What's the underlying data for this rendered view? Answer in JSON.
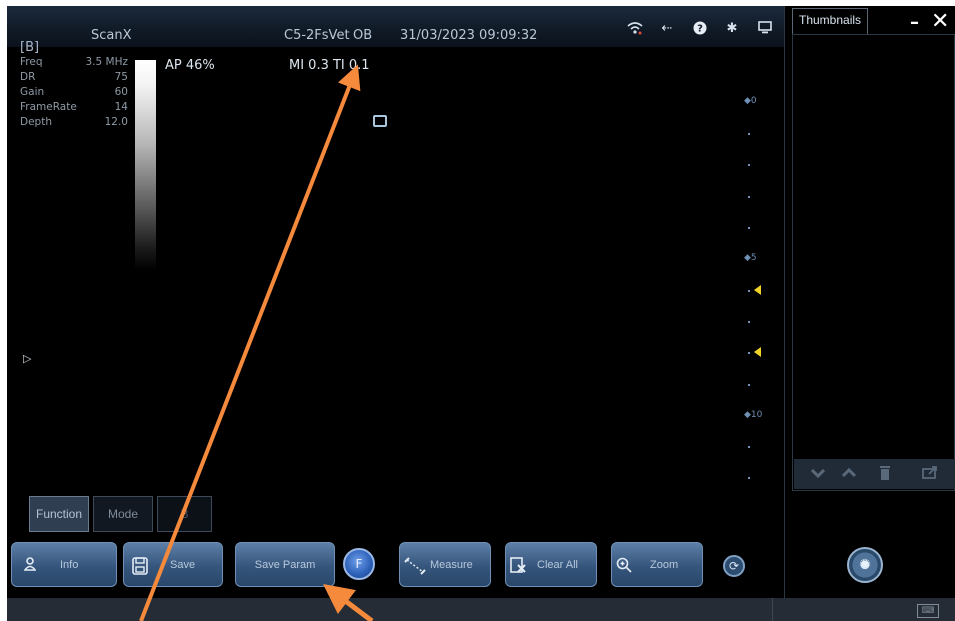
{
  "header": {
    "app_name": "ScanX",
    "probe": "C5-2FsVet",
    "preset": "OB",
    "datetime": "31/03/2023 09:09:32"
  },
  "header_icons": [
    "wifi-icon",
    "usb-icon",
    "help-icon",
    "settings-icon",
    "display-icon"
  ],
  "thumbnails": {
    "tab_label": "Thumbnails",
    "toolbar_icons": [
      "chevron-down-icon",
      "chevron-up-icon",
      "trash-icon",
      "export-icon"
    ]
  },
  "window": {
    "minimize": "–",
    "close": "✕"
  },
  "imaging": {
    "mode_tag": "[B]",
    "params": [
      {
        "label": "Freq",
        "value": "3.5 MHz"
      },
      {
        "label": "DR",
        "value": "75"
      },
      {
        "label": "Gain",
        "value": "60"
      },
      {
        "label": "FrameRate",
        "value": "14"
      },
      {
        "label": "Depth",
        "value": "12.0"
      }
    ],
    "ap": "AP 46%",
    "mi": "MI 0.3 TI 0.1"
  },
  "depth_scale": {
    "labels": [
      "0",
      "5",
      "10"
    ],
    "focus_markers": 2
  },
  "tabs": {
    "function": "Function",
    "mode": "Mode",
    "b": "B"
  },
  "controls": {
    "info": "Info",
    "save": "Save",
    "save_param": "Save Param",
    "freeze": "F",
    "measure": "Measure",
    "clear_all": "Clear All",
    "zoom": "Zoom"
  },
  "accent_colors": {
    "annotation_arrow": "#f58a3c",
    "depth_scale": "#6f8fb5",
    "focus_marker": "#f1d327",
    "button": "#3f628a"
  }
}
